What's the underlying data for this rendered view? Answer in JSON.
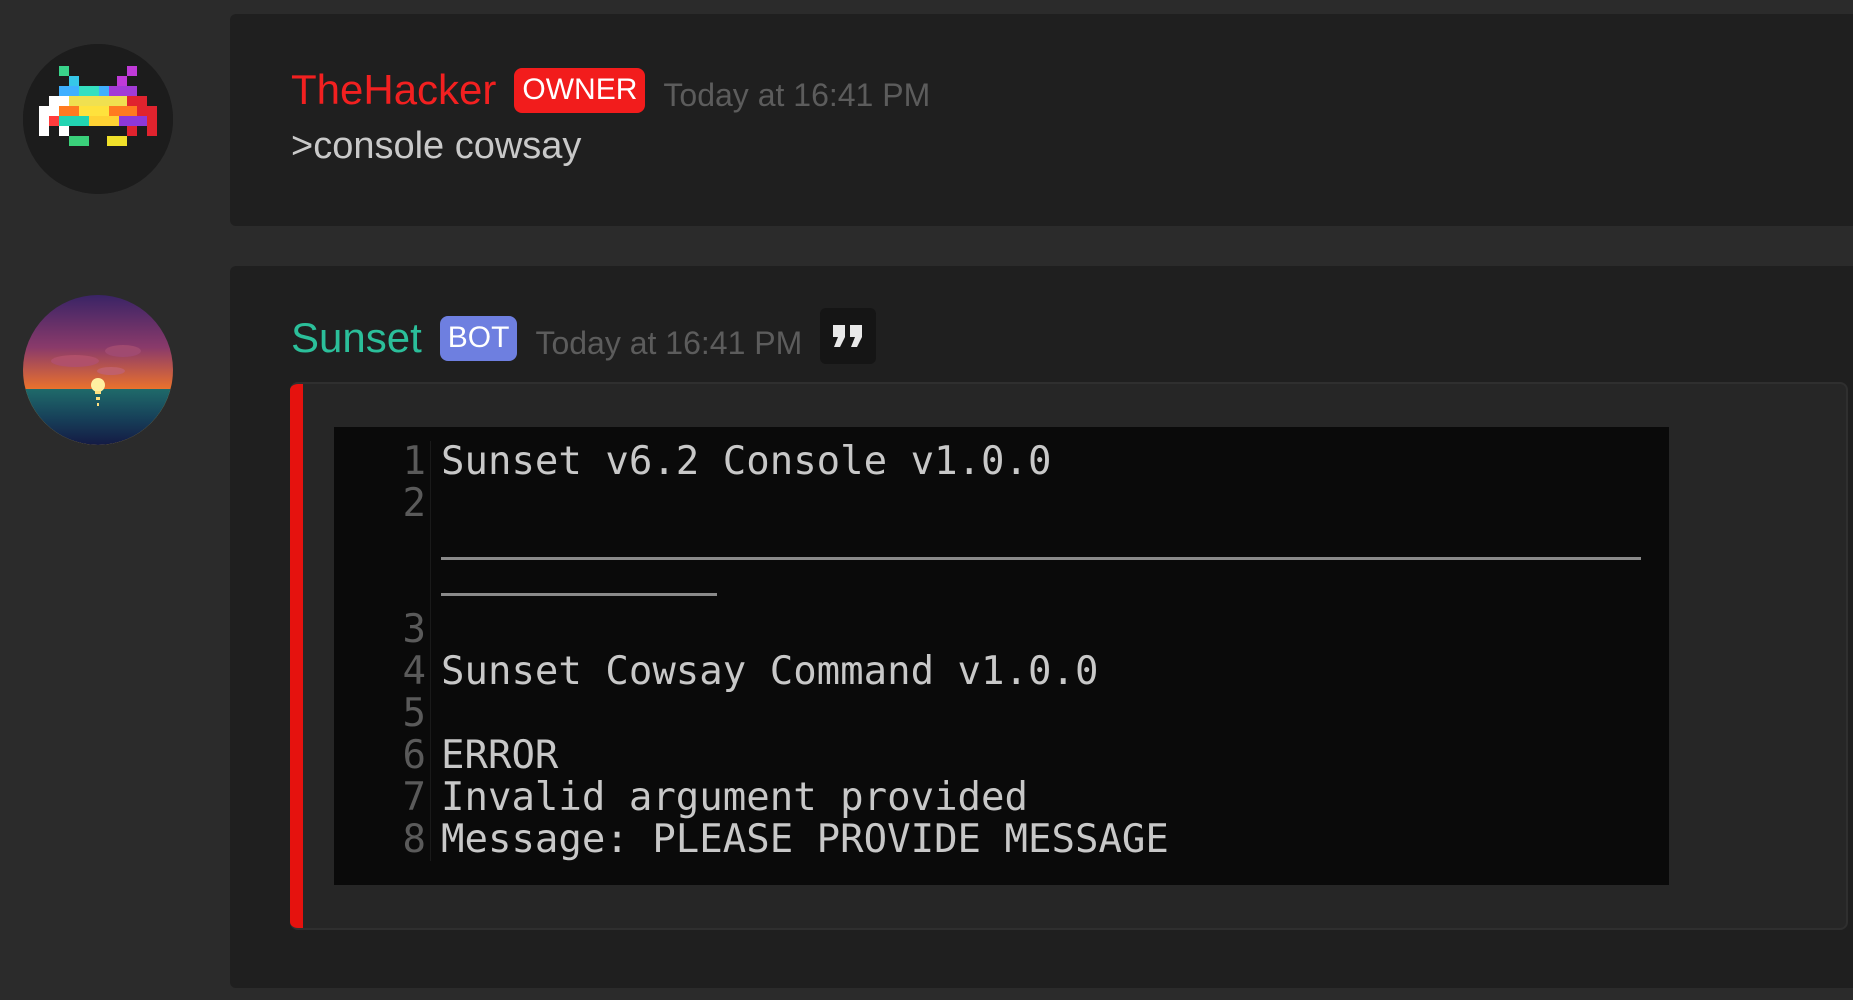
{
  "messages": [
    {
      "author": "TheHacker",
      "badge": "OWNER",
      "timestamp": "Today at 16:41 PM",
      "content": ">console cowsay",
      "avatar_icon": "space-invader-icon",
      "name_color": "#f22020",
      "badge_color": "#f21c1c"
    },
    {
      "author": "Sunset",
      "badge": "BOT",
      "timestamp": "Today at 16:41 PM",
      "avatar_icon": "sunset-icon",
      "name_color": "#2bbf9a",
      "badge_color": "#6e7fe0",
      "quote_icon": "quote-icon",
      "embed": {
        "accent_color": "#e5120e",
        "code_lines": [
          {
            "number": "1",
            "text": "Sunset v6.2 Console v1.0.0"
          },
          {
            "number": "2",
            "text": ""
          },
          {
            "number": "3",
            "text": ""
          },
          {
            "number": "4",
            "text": "Sunset Cowsay Command v1.0.0"
          },
          {
            "number": "5",
            "text": ""
          },
          {
            "number": "6",
            "text": "ERROR"
          },
          {
            "number": "7",
            "text": "Invalid argument provided"
          },
          {
            "number": "8",
            "text": "Message: PLEASE PROVIDE MESSAGE"
          }
        ]
      }
    }
  ]
}
